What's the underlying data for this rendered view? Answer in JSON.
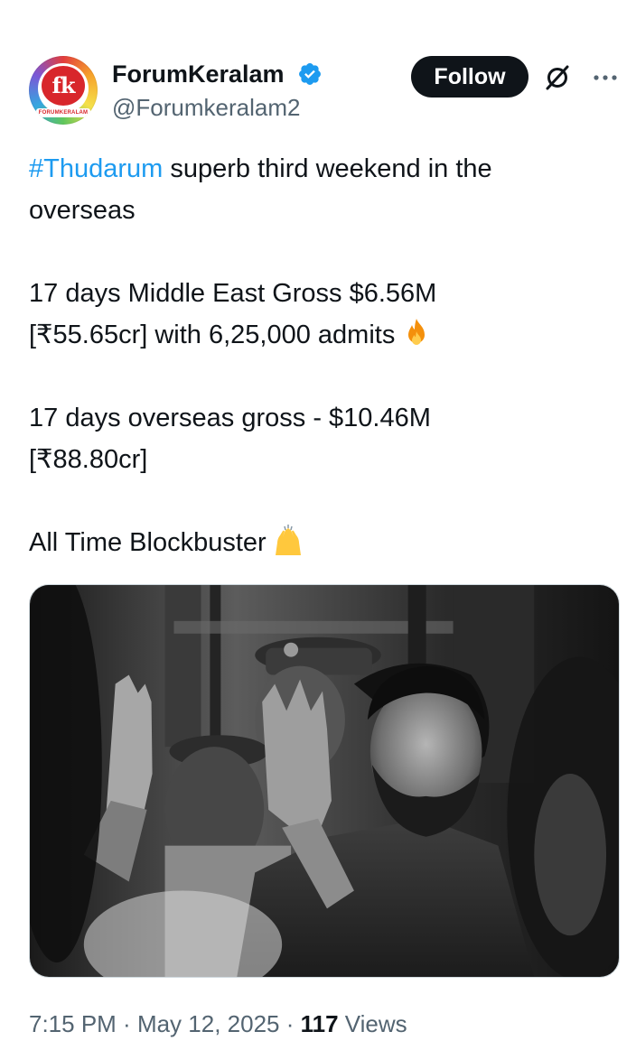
{
  "author": {
    "display_name": "ForumKeralam",
    "handle": "@Forumkeralam2",
    "verified": true,
    "avatar_logo_text": "fk",
    "avatar_strip_text": "FORUMKERALAM",
    "avatar_icon": "fk-logo-avatar"
  },
  "actions": {
    "follow_label": "Follow",
    "grok_icon": "grok-icon",
    "more_icon": "more-options-icon"
  },
  "tweet": {
    "hashtag": "#Thudarum",
    "line1_rest": " superb third weekend in the",
    "line2": "overseas",
    "line3": "17 days Middle East Gross $6.56M",
    "line4": "[₹55.65cr] with 6,25,000 admits",
    "line4_emoji": "fire-emoji",
    "line5": "17 days overseas gross - $10.46M",
    "line6": "[₹88.80cr]",
    "line7": "All Time Blockbuster",
    "line7_emoji": "raising-hands-emoji"
  },
  "media": {
    "type": "photo",
    "style": "black-and-white"
  },
  "meta": {
    "time": "7:15 PM",
    "separator": " · ",
    "date": "May 12, 2025",
    "views_count": "117",
    "views_label": " Views"
  },
  "colors": {
    "text": "#0f1419",
    "secondary": "#536471",
    "link": "#1d9bf0",
    "verified": "#1d9bf0",
    "follow_bg": "#0f1419",
    "follow_text": "#ffffff",
    "border": "#cfd9de"
  }
}
